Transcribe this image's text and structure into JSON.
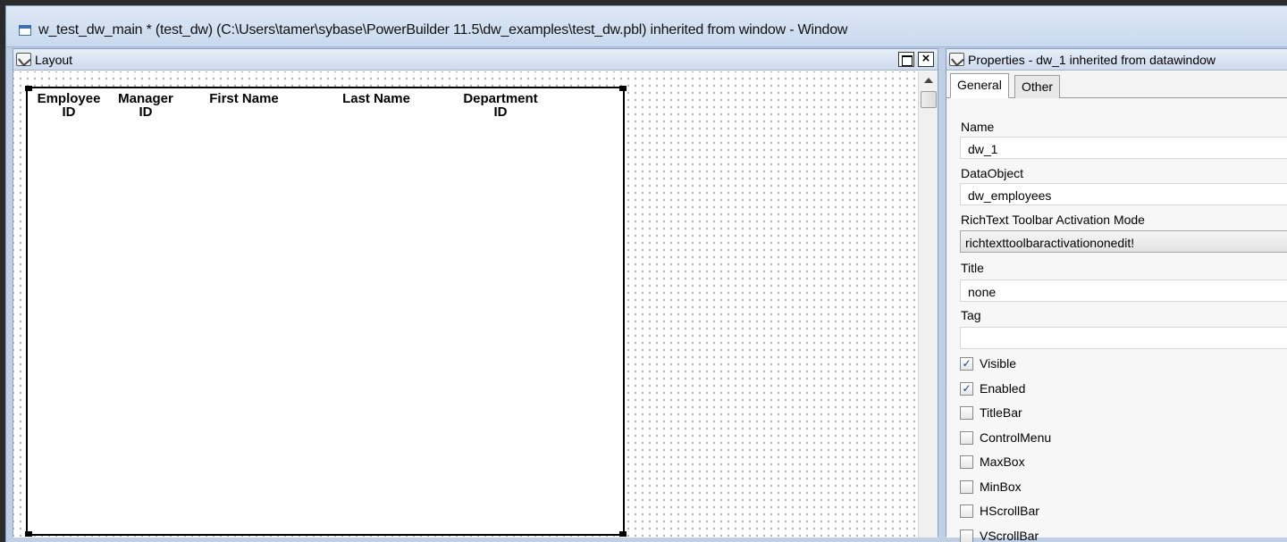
{
  "window": {
    "title": "w_test_dw_main * (test_dw) (C:\\Users\\tamer\\sybase\\PowerBuilder 11.5\\dw_examples\\test_dw.pbl) inherited from window - Window"
  },
  "layout_panel": {
    "title": "Layout",
    "maximize_glyph": "",
    "close_glyph": "×",
    "column_headers": [
      {
        "line1": "Employee",
        "line2": "ID"
      },
      {
        "line1": "Manager",
        "line2": "ID"
      },
      {
        "line1": "First Name",
        "line2": ""
      },
      {
        "line1": "Last Name",
        "line2": ""
      },
      {
        "line1": "Department",
        "line2": "ID"
      }
    ]
  },
  "properties_panel": {
    "title": "Properties - dw_1 inherited from datawindow",
    "tabs": [
      "General",
      "Other"
    ],
    "active_tab": "General",
    "fields": {
      "name_label": "Name",
      "name_value": "dw_1",
      "dataobject_label": "DataObject",
      "dataobject_value": "dw_employees",
      "richtext_label": "RichText Toolbar Activation Mode",
      "richtext_value": "richtexttoolbaractivationonedit!",
      "title_label": "Title",
      "title_value": "none",
      "tag_label": "Tag",
      "tag_value": ""
    },
    "checkboxes": [
      {
        "label": "Visible",
        "checked": true
      },
      {
        "label": "Enabled",
        "checked": true
      },
      {
        "label": "TitleBar",
        "checked": false
      },
      {
        "label": "ControlMenu",
        "checked": false
      },
      {
        "label": "MaxBox",
        "checked": false
      },
      {
        "label": "MinBox",
        "checked": false
      },
      {
        "label": "HScrollBar",
        "checked": false
      },
      {
        "label": "VScrollBar",
        "checked": false
      }
    ]
  }
}
